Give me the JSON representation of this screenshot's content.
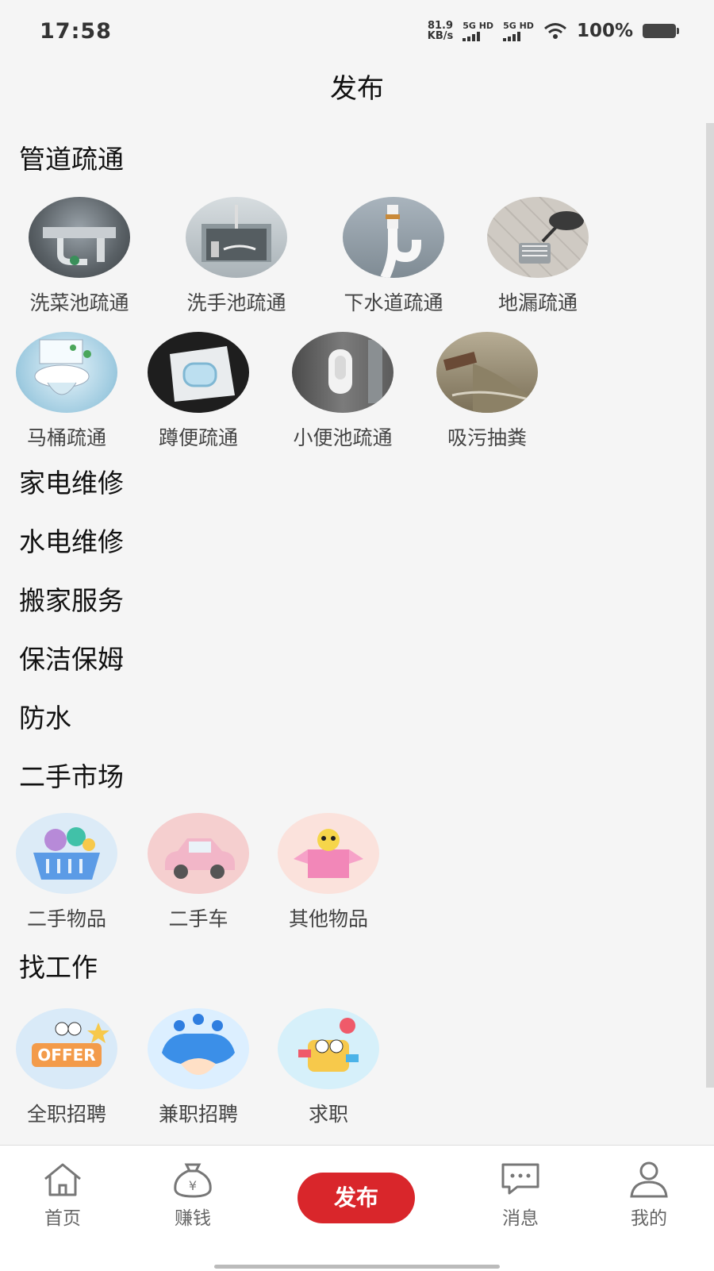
{
  "status_bar": {
    "time": "17:58",
    "net_speed_value": "81.9",
    "net_speed_unit": "KB/s",
    "signal1_label": "5G HD",
    "signal2_label": "5G HD",
    "battery": "100%"
  },
  "header": {
    "title": "发布"
  },
  "categories": {
    "pipe": {
      "title": "管道疏通",
      "items": [
        "洗菜池疏通",
        "洗手池疏通",
        "下水道疏通",
        "地漏疏通",
        "马桶疏通",
        "蹲便疏通",
        "小便池疏通",
        "吸污抽粪"
      ]
    },
    "appliance": {
      "title": "家电维修"
    },
    "plumbing": {
      "title": "水电维修"
    },
    "moving": {
      "title": "搬家服务"
    },
    "cleaning": {
      "title": "保洁保姆"
    },
    "waterproof": {
      "title": "防水"
    },
    "secondhand": {
      "title": "二手市场",
      "items": [
        "二手物品",
        "二手车",
        "其他物品"
      ]
    },
    "jobs": {
      "title": "找工作",
      "items": [
        "全职招聘",
        "兼职招聘",
        "求职"
      ]
    }
  },
  "tabbar": {
    "home": "首页",
    "earn": "赚钱",
    "publish": "发布",
    "messages": "消息",
    "mine": "我的"
  },
  "colors": {
    "accent": "#d9262b",
    "background": "#f5f5f5"
  }
}
